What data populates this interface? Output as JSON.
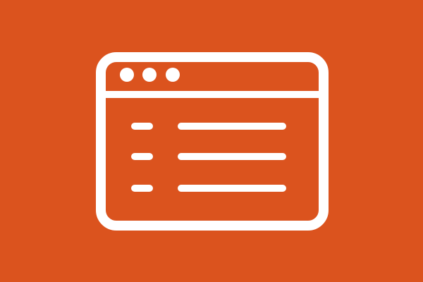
{
  "background_color": "#db531e",
  "icon": {
    "name": "browser-window-list-icon",
    "stroke_color": "#ffffff",
    "window_control_dots": 3,
    "list_rows": 3
  }
}
